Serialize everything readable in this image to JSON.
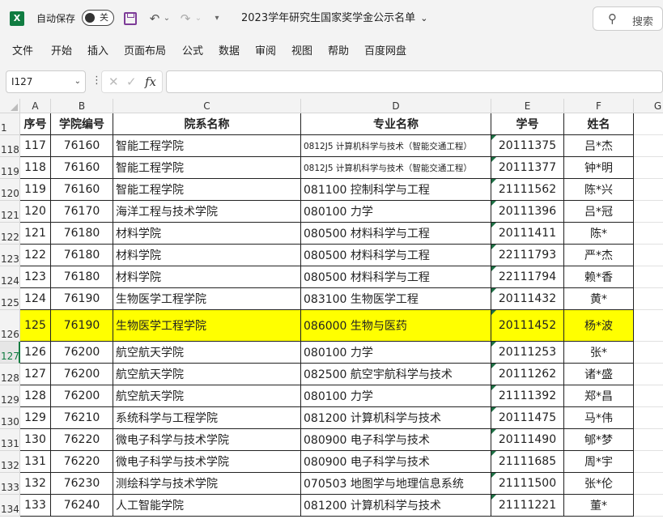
{
  "app": {
    "logo_letter": "X",
    "autosave_label": "自动保存",
    "autosave_state": "关",
    "document_title": "2023学年研究生国家奖学金公示名单",
    "search_label": "搜索"
  },
  "icons": {
    "excel": "excel-logo-icon",
    "save": "save-icon",
    "undo": "undo-icon",
    "redo": "redo-icon",
    "customize": "customize-qat-icon",
    "search": "search-icon"
  },
  "menu": [
    "文件",
    "开始",
    "插入",
    "页面布局",
    "公式",
    "数据",
    "审阅",
    "视图",
    "帮助",
    "百度网盘"
  ],
  "formula_bar": {
    "name_box": "I127",
    "fx_label": "fx",
    "formula": ""
  },
  "grid": {
    "columns": [
      "A",
      "B",
      "C",
      "D",
      "E",
      "F",
      "G"
    ],
    "header_row": {
      "row_number": "1",
      "cells": [
        "序号",
        "学院编号",
        "院系名称",
        "专业名称",
        "学号",
        "姓名"
      ]
    },
    "rows": [
      {
        "row_number": "118",
        "cells": [
          "117",
          "76160",
          "智能工程学院",
          "0812J5 计算机科学与技术（智能交通工程）",
          "20111375",
          "吕*杰"
        ]
      },
      {
        "row_number": "119",
        "cells": [
          "118",
          "76160",
          "智能工程学院",
          "0812J5 计算机科学与技术（智能交通工程）",
          "20111377",
          "钟*明"
        ]
      },
      {
        "row_number": "120",
        "cells": [
          "119",
          "76160",
          "智能工程学院",
          "081100 控制科学与工程",
          "21111562",
          "陈*兴"
        ]
      },
      {
        "row_number": "121",
        "cells": [
          "120",
          "76170",
          "海洋工程与技术学院",
          "080100 力学",
          "20111396",
          "吕*冠"
        ]
      },
      {
        "row_number": "122",
        "cells": [
          "121",
          "76180",
          "材料学院",
          "080500 材料科学与工程",
          "20111411",
          "陈*"
        ]
      },
      {
        "row_number": "123",
        "cells": [
          "122",
          "76180",
          "材料学院",
          "080500 材料科学与工程",
          "22111793",
          "严*杰"
        ]
      },
      {
        "row_number": "124",
        "cells": [
          "123",
          "76180",
          "材料学院",
          "080500 材料科学与工程",
          "22111794",
          "赖*香"
        ]
      },
      {
        "row_number": "125",
        "cells": [
          "124",
          "76190",
          "生物医学工程学院",
          "083100 生物医学工程",
          "20111432",
          "黄*"
        ]
      },
      {
        "row_number": "126",
        "cells": [
          "125",
          "76190",
          "生物医学工程学院",
          "086000 生物与医药",
          "20111452",
          "杨*波"
        ]
      },
      {
        "row_number": "127",
        "cells": [
          "126",
          "76200",
          "航空航天学院",
          "080100 力学",
          "20111253",
          "张*"
        ]
      },
      {
        "row_number": "128",
        "cells": [
          "127",
          "76200",
          "航空航天学院",
          "082500 航空宇航科学与技术",
          "20111262",
          "诸*盛"
        ]
      },
      {
        "row_number": "129",
        "cells": [
          "128",
          "76200",
          "航空航天学院",
          "080100 力学",
          "21111392",
          "郑*昌"
        ]
      },
      {
        "row_number": "130",
        "cells": [
          "129",
          "76210",
          "系统科学与工程学院",
          "081200 计算机科学与技术",
          "20111475",
          "马*伟"
        ]
      },
      {
        "row_number": "131",
        "cells": [
          "130",
          "76220",
          "微电子科学与技术学院",
          "080900 电子科学与技术",
          "20111490",
          "郇*梦"
        ]
      },
      {
        "row_number": "132",
        "cells": [
          "131",
          "76220",
          "微电子科学与技术学院",
          "080900 电子科学与技术",
          "21111685",
          "周*宇"
        ]
      },
      {
        "row_number": "133",
        "cells": [
          "132",
          "76230",
          "测绘科学与技术学院",
          "070503 地图学与地理信息系统",
          "21111500",
          "张*伦"
        ]
      },
      {
        "row_number": "134",
        "cells": [
          "133",
          "76240",
          "人工智能学院",
          "081200 计算机科学与技术",
          "21111221",
          "董*"
        ]
      }
    ],
    "selected_row": "127",
    "highlight_row": "126",
    "highlight_color": "#ffff00"
  },
  "colors": {
    "accent": "#107c41",
    "save_icon": "#7d3c98"
  }
}
